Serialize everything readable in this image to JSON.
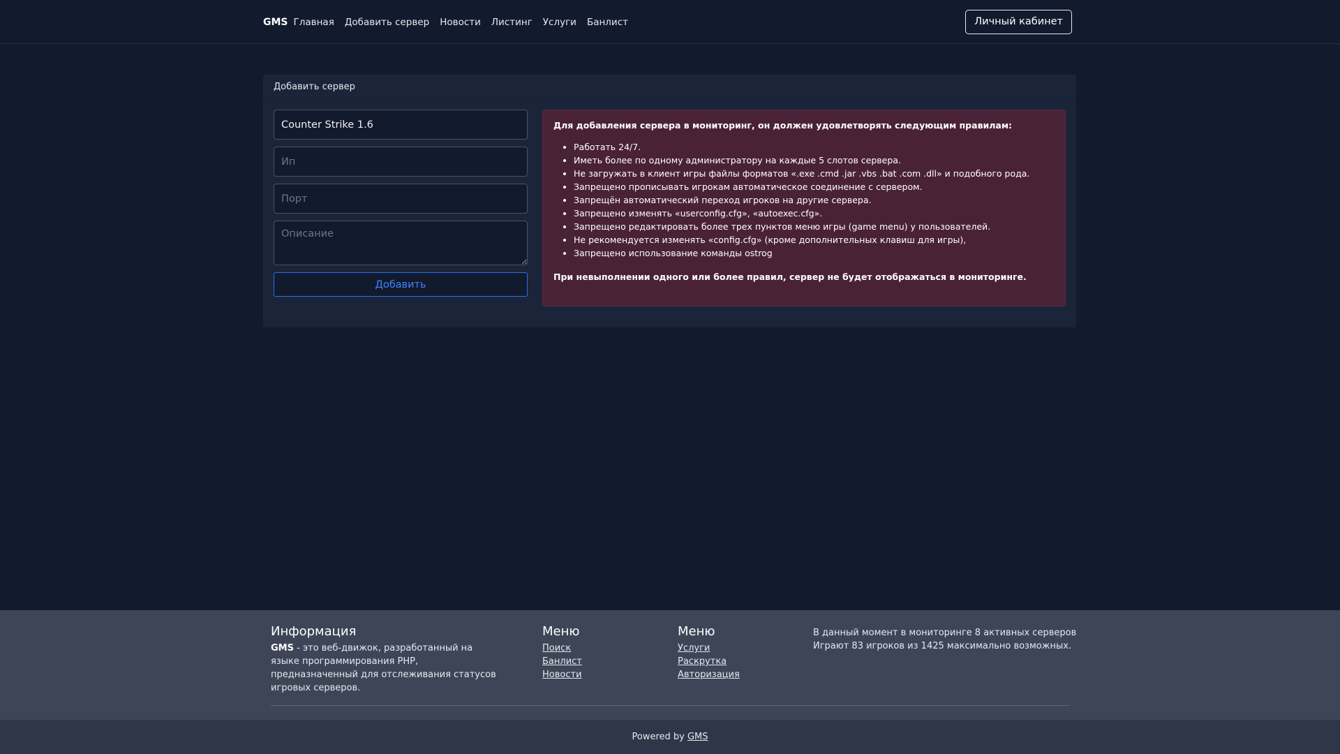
{
  "header": {
    "brand": "GMS",
    "nav": [
      "Главная",
      "Добавить сервер",
      "Новости",
      "Листинг",
      "Услуги",
      "Банлист"
    ],
    "cabinet_label": "Личный кабинет"
  },
  "card": {
    "title": "Добавить сервер",
    "form": {
      "game_value": "Counter Strike 1.6",
      "ip_placeholder": "Ип",
      "port_placeholder": "Порт",
      "description_placeholder": "Описание",
      "submit_label": "Добавить"
    },
    "rules": {
      "title": "Для добавления сервера в мониторинг, он должен удовлетворять следующим правилам:",
      "items": [
        "Работать 24/7.",
        "Иметь более по одному администратору на каждые 5 слотов сервера.",
        "Не загружать в клиент игры файлы форматов «.exe .cmd .jar .vbs .bat .com .dll» и подобного рода.",
        "Запрещено прописывать игрокам автоматическое соединение с сервером.",
        "Запрещён автоматический переход игроков на другие сервера.",
        "Запрещено изменять  «userconfig.cfg», «autoexec.cfg».",
        "Запрещено редактировать более трех пунктов меню игры (game menu) у пользователей.",
        "Не рекомендуется изменять «config.cfg» (кроме дополнительных клавиш для игры),",
        "Запрещено использование команды ostrog"
      ],
      "footer": "При невыполнении одного или более правил, сервер не будет отображаться в мониторинге."
    }
  },
  "footer": {
    "info_title": "Информация",
    "info_brand": "GMS",
    "info_text": " - это веб-движок, разработанный на языке программирования PHP, предназначенный для отслеживания статусов игровых серверов.",
    "menu1_title": "Меню",
    "menu1_links": [
      "Поиск",
      "Банлист",
      "Новости"
    ],
    "menu2_title": "Меню",
    "menu2_links": [
      "Услуги",
      "Раскрутка",
      "Авторизация"
    ],
    "stats_line1": "В данный момент в мониторинге 8 активных серверов",
    "stats_line2": "Играют 83 игроков из 1425 максимально возможных.",
    "powered_text": "Powered by ",
    "powered_link": "GMS"
  }
}
